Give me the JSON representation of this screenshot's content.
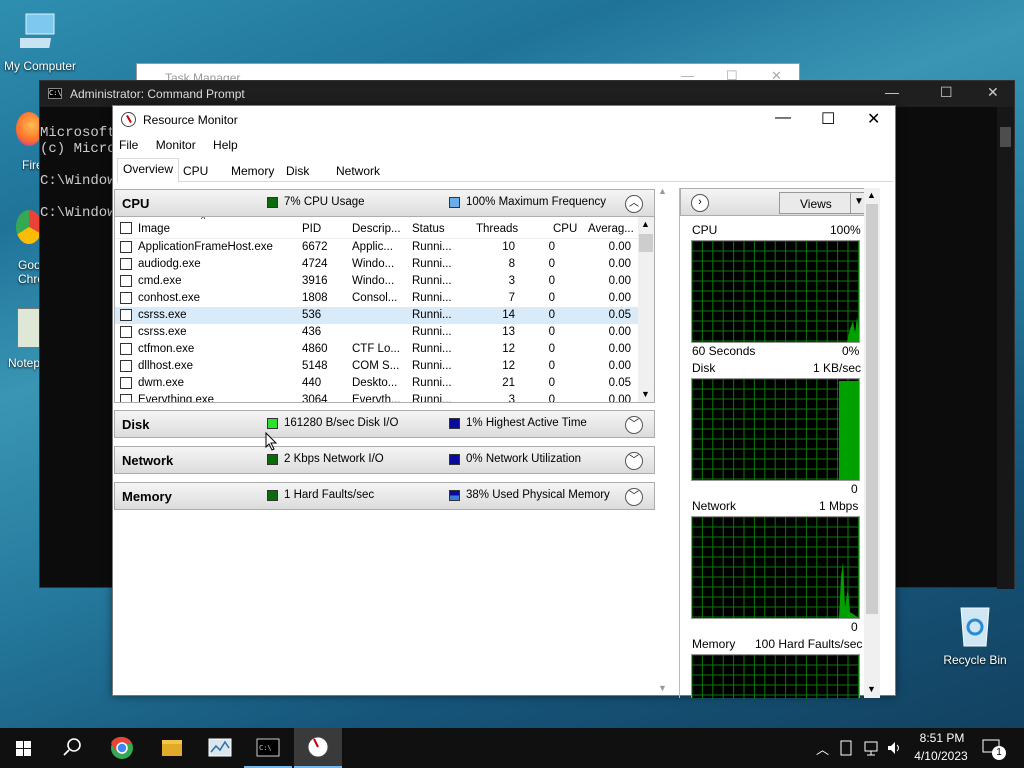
{
  "desktop": {
    "icons": [
      {
        "label": "My Computer"
      },
      {
        "label": "Fire"
      },
      {
        "label": "Goo Chro"
      },
      {
        "label": "Notep"
      },
      {
        "label": "Recycle Bin"
      }
    ]
  },
  "task_manager": {
    "title": "Task Manager"
  },
  "cmd": {
    "title": "Administrator: Command Prompt",
    "lines": [
      "Microsoft",
      "(c) Micro",
      "",
      "C:\\Window",
      "",
      "C:\\Window"
    ]
  },
  "rm": {
    "title": "Resource Monitor",
    "menu": [
      "File",
      "Monitor",
      "Help"
    ],
    "tabs": [
      "Overview",
      "CPU",
      "Memory",
      "Disk",
      "Network"
    ],
    "cpu": {
      "name": "CPU",
      "usage": "7% CPU Usage",
      "freq": "100% Maximum Frequency"
    },
    "columns": [
      "Image",
      "PID",
      "Descrip...",
      "Status",
      "Threads",
      "CPU",
      "Averag..."
    ],
    "rows": [
      [
        "ApplicationFrameHost.exe",
        "6672",
        "Applic...",
        "Runni...",
        "10",
        "0",
        "0.00"
      ],
      [
        "audiodg.exe",
        "4724",
        "Windo...",
        "Runni...",
        "8",
        "0",
        "0.00"
      ],
      [
        "cmd.exe",
        "3916",
        "Windo...",
        "Runni...",
        "3",
        "0",
        "0.00"
      ],
      [
        "conhost.exe",
        "1808",
        "Consol...",
        "Runni...",
        "7",
        "0",
        "0.00"
      ],
      [
        "csrss.exe",
        "536",
        "",
        "Runni...",
        "14",
        "0",
        "0.05"
      ],
      [
        "csrss.exe",
        "436",
        "",
        "Runni...",
        "13",
        "0",
        "0.00"
      ],
      [
        "ctfmon.exe",
        "4860",
        "CTF Lo...",
        "Runni...",
        "12",
        "0",
        "0.00"
      ],
      [
        "dllhost.exe",
        "5148",
        "COM S...",
        "Runni...",
        "12",
        "0",
        "0.00"
      ],
      [
        "dwm.exe",
        "440",
        "Deskto...",
        "Runni...",
        "21",
        "0",
        "0.05"
      ],
      [
        "Everything.exe",
        "3064",
        "Everyth...",
        "Runni...",
        "3",
        "0",
        "0.00"
      ]
    ],
    "selected_row": 4,
    "disk": {
      "name": "Disk",
      "io": "161280 B/sec Disk I/O",
      "active": "1% Highest Active Time"
    },
    "network": {
      "name": "Network",
      "io": "2 Kbps Network I/O",
      "util": "0% Network Utilization"
    },
    "memory": {
      "name": "Memory",
      "faults": "1 Hard Faults/sec",
      "used": "38% Used Physical Memory"
    },
    "views": "Views",
    "graphs": {
      "cpu": {
        "label": "CPU",
        "max": "100%",
        "time": "60 Seconds",
        "min": "0%"
      },
      "disk": {
        "label": "Disk",
        "max": "1 KB/sec",
        "min": "0"
      },
      "network": {
        "label": "Network",
        "max": "1 Mbps",
        "min": "0"
      },
      "memory": {
        "label": "Memory",
        "max": "100 Hard Faults/sec"
      }
    }
  },
  "taskbar": {
    "time": "8:51 PM",
    "date": "4/10/2023",
    "notif": "1"
  },
  "colors": {
    "graph_green": "#00a000",
    "grid": "#0a7a0a"
  }
}
